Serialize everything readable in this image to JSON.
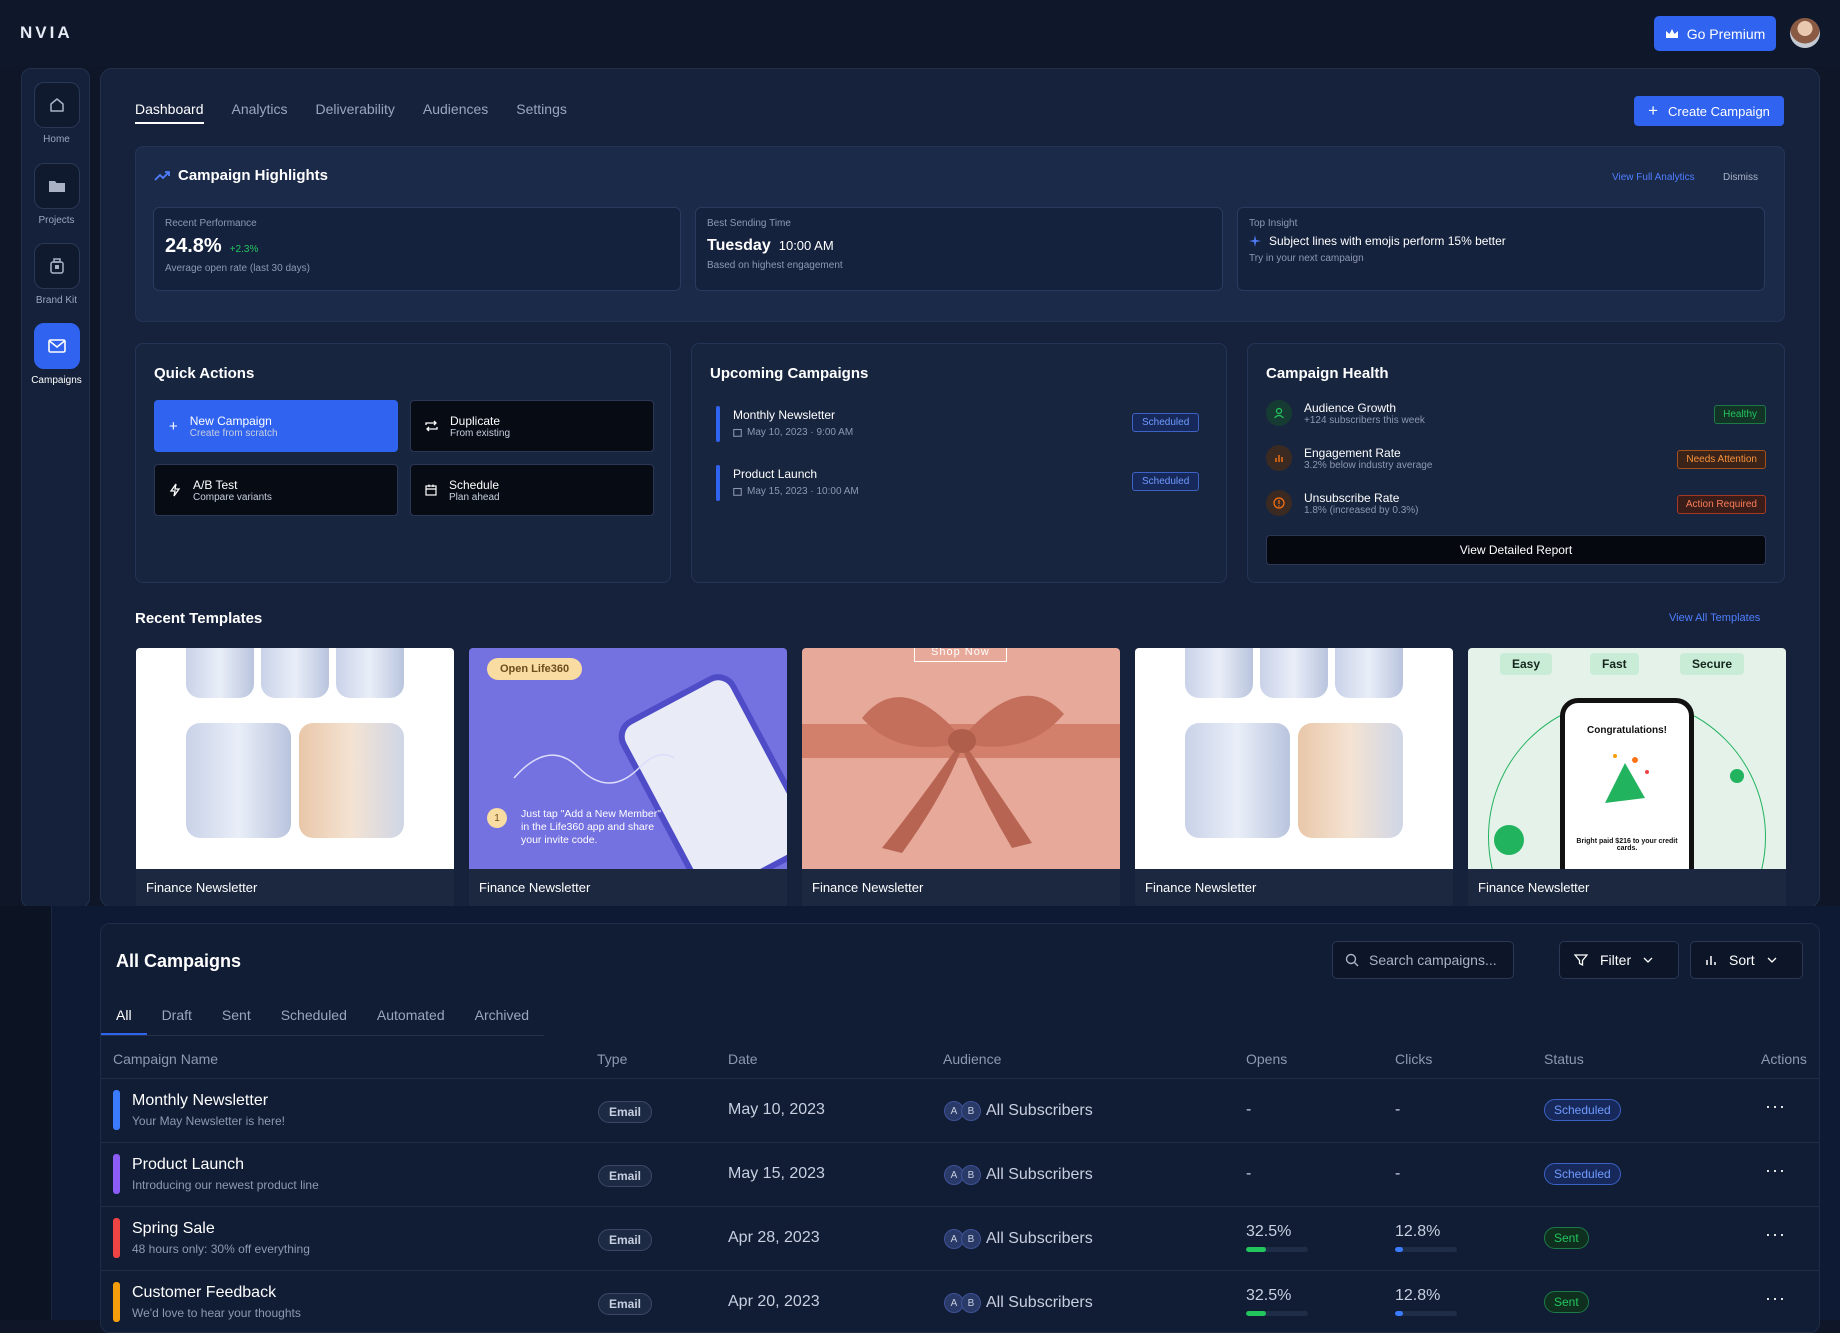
{
  "app": {
    "logo": "NVIA",
    "premium_label": "Go Premium"
  },
  "sidebar": {
    "items": [
      {
        "label": "Home"
      },
      {
        "label": "Projects"
      },
      {
        "label": "Brand Kit"
      },
      {
        "label": "Campaigns"
      }
    ]
  },
  "tabs": [
    "Dashboard",
    "Analytics",
    "Deliverability",
    "Audiences",
    "Settings"
  ],
  "create_label": "Create Campaign",
  "highlights": {
    "title": "Campaign Highlights",
    "view_full": "View Full Analytics",
    "dismiss": "Dismiss",
    "recent": {
      "label": "Recent Performance",
      "value": "24.8%",
      "delta": "+2.3%",
      "note": "Average open rate (last 30 days)"
    },
    "best_time": {
      "label": "Best Sending Time",
      "day": "Tuesday",
      "time": "10:00 AM",
      "note": "Based on highest engagement"
    },
    "insight": {
      "label": "Top Insight",
      "text": "Subject lines with emojis perform 15% better",
      "note": "Try in your next campaign"
    }
  },
  "quick_actions": {
    "title": "Quick Actions",
    "items": [
      {
        "title": "New Campaign",
        "sub": "Create from scratch"
      },
      {
        "title": "Duplicate",
        "sub": "From existing"
      },
      {
        "title": "A/B Test",
        "sub": "Compare variants"
      },
      {
        "title": "Schedule",
        "sub": "Plan ahead"
      }
    ]
  },
  "upcoming": {
    "title": "Upcoming Campaigns",
    "items": [
      {
        "name": "Monthly Newsletter",
        "meta": "May 10, 2023 · 9:00 AM",
        "status": "Scheduled"
      },
      {
        "name": "Product Launch",
        "meta": "May 15, 2023 · 10:00 AM",
        "status": "Scheduled"
      }
    ]
  },
  "health": {
    "title": "Campaign Health",
    "items": [
      {
        "name": "Audience Growth",
        "sub": "+124 subscribers this week",
        "badge": "Healthy"
      },
      {
        "name": "Engagement Rate",
        "sub": "3.2% below industry average",
        "badge": "Needs Attention"
      },
      {
        "name": "Unsubscribe Rate",
        "sub": "1.8% (increased by 0.3%)",
        "badge": "Action Required"
      }
    ],
    "report_label": "View Detailed Report"
  },
  "templates": {
    "title": "Recent Templates",
    "view_all": "View All Templates",
    "items": [
      {
        "name": "Finance Newsletter"
      },
      {
        "name": "Finance Newsletter",
        "banner": "Open Life360",
        "step": "1",
        "text": "Just tap \"Add a New Member\" in the Life360 app and share your invite code."
      },
      {
        "name": "Finance Newsletter",
        "banner": "Shop Now"
      },
      {
        "name": "Finance Newsletter"
      },
      {
        "name": "Finance Newsletter",
        "pills": [
          "Easy",
          "Fast",
          "Secure"
        ],
        "headline": "Congratulations!",
        "footer": "Bright paid $216 to your credit cards."
      }
    ]
  },
  "campaigns": {
    "title": "All Campaigns",
    "search_placeholder": "Search campaigns...",
    "filter_label": "Filter",
    "sort_label": "Sort",
    "tabs": [
      "All",
      "Draft",
      "Sent",
      "Scheduled",
      "Automated",
      "Archived"
    ],
    "columns": [
      "Campaign Name",
      "Type",
      "Date",
      "Audience",
      "Opens",
      "Clicks",
      "Status",
      "Actions"
    ],
    "rows": [
      {
        "name": "Monthly Newsletter",
        "sub": "Your May Newsletter is here!",
        "type": "Email",
        "date": "May 10, 2023",
        "audience": "All Subscribers",
        "opens": "-",
        "clicks": "-",
        "opens_frac": 0,
        "clicks_frac": 0,
        "status": "Scheduled",
        "color": "#3b7bff"
      },
      {
        "name": "Product Launch",
        "sub": "Introducing our newest product line",
        "type": "Email",
        "date": "May 15, 2023",
        "audience": "All Subscribers",
        "opens": "-",
        "clicks": "-",
        "opens_frac": 0,
        "clicks_frac": 0,
        "status": "Scheduled",
        "color": "#8b5cf6"
      },
      {
        "name": "Spring Sale",
        "sub": "48 hours only: 30% off everything",
        "type": "Email",
        "date": "Apr 28, 2023",
        "audience": "All Subscribers",
        "opens": "32.5%",
        "clicks": "12.8%",
        "opens_frac": 0.325,
        "clicks_frac": 0.128,
        "status": "Sent",
        "color": "#ef4444"
      },
      {
        "name": "Customer Feedback",
        "sub": "We'd love to hear your thoughts",
        "type": "Email",
        "date": "Apr 20, 2023",
        "audience": "All Subscribers",
        "opens": "32.5%",
        "clicks": "12.8%",
        "opens_frac": 0.325,
        "clicks_frac": 0.128,
        "status": "Sent",
        "color": "#f59e0b"
      }
    ],
    "avatar_letters": [
      "A",
      "B"
    ],
    "actions_glyph": "···"
  }
}
